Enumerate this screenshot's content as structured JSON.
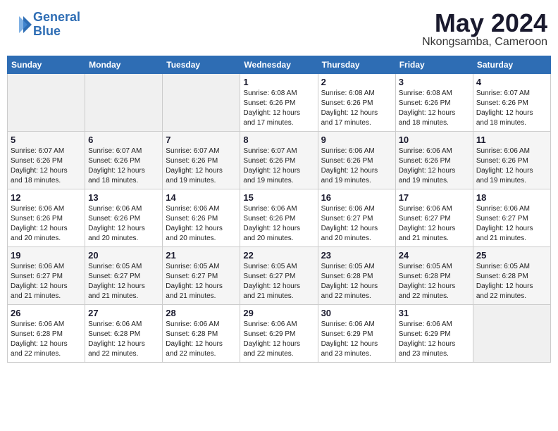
{
  "header": {
    "logo_line1": "General",
    "logo_line2": "Blue",
    "month_year": "May 2024",
    "location": "Nkongsamba, Cameroon"
  },
  "weekdays": [
    "Sunday",
    "Monday",
    "Tuesday",
    "Wednesday",
    "Thursday",
    "Friday",
    "Saturday"
  ],
  "weeks": [
    [
      {
        "day": "",
        "info": ""
      },
      {
        "day": "",
        "info": ""
      },
      {
        "day": "",
        "info": ""
      },
      {
        "day": "1",
        "info": "Sunrise: 6:08 AM\nSunset: 6:26 PM\nDaylight: 12 hours\nand 17 minutes."
      },
      {
        "day": "2",
        "info": "Sunrise: 6:08 AM\nSunset: 6:26 PM\nDaylight: 12 hours\nand 17 minutes."
      },
      {
        "day": "3",
        "info": "Sunrise: 6:08 AM\nSunset: 6:26 PM\nDaylight: 12 hours\nand 18 minutes."
      },
      {
        "day": "4",
        "info": "Sunrise: 6:07 AM\nSunset: 6:26 PM\nDaylight: 12 hours\nand 18 minutes."
      }
    ],
    [
      {
        "day": "5",
        "info": "Sunrise: 6:07 AM\nSunset: 6:26 PM\nDaylight: 12 hours\nand 18 minutes."
      },
      {
        "day": "6",
        "info": "Sunrise: 6:07 AM\nSunset: 6:26 PM\nDaylight: 12 hours\nand 18 minutes."
      },
      {
        "day": "7",
        "info": "Sunrise: 6:07 AM\nSunset: 6:26 PM\nDaylight: 12 hours\nand 19 minutes."
      },
      {
        "day": "8",
        "info": "Sunrise: 6:07 AM\nSunset: 6:26 PM\nDaylight: 12 hours\nand 19 minutes."
      },
      {
        "day": "9",
        "info": "Sunrise: 6:06 AM\nSunset: 6:26 PM\nDaylight: 12 hours\nand 19 minutes."
      },
      {
        "day": "10",
        "info": "Sunrise: 6:06 AM\nSunset: 6:26 PM\nDaylight: 12 hours\nand 19 minutes."
      },
      {
        "day": "11",
        "info": "Sunrise: 6:06 AM\nSunset: 6:26 PM\nDaylight: 12 hours\nand 19 minutes."
      }
    ],
    [
      {
        "day": "12",
        "info": "Sunrise: 6:06 AM\nSunset: 6:26 PM\nDaylight: 12 hours\nand 20 minutes."
      },
      {
        "day": "13",
        "info": "Sunrise: 6:06 AM\nSunset: 6:26 PM\nDaylight: 12 hours\nand 20 minutes."
      },
      {
        "day": "14",
        "info": "Sunrise: 6:06 AM\nSunset: 6:26 PM\nDaylight: 12 hours\nand 20 minutes."
      },
      {
        "day": "15",
        "info": "Sunrise: 6:06 AM\nSunset: 6:26 PM\nDaylight: 12 hours\nand 20 minutes."
      },
      {
        "day": "16",
        "info": "Sunrise: 6:06 AM\nSunset: 6:27 PM\nDaylight: 12 hours\nand 20 minutes."
      },
      {
        "day": "17",
        "info": "Sunrise: 6:06 AM\nSunset: 6:27 PM\nDaylight: 12 hours\nand 21 minutes."
      },
      {
        "day": "18",
        "info": "Sunrise: 6:06 AM\nSunset: 6:27 PM\nDaylight: 12 hours\nand 21 minutes."
      }
    ],
    [
      {
        "day": "19",
        "info": "Sunrise: 6:06 AM\nSunset: 6:27 PM\nDaylight: 12 hours\nand 21 minutes."
      },
      {
        "day": "20",
        "info": "Sunrise: 6:05 AM\nSunset: 6:27 PM\nDaylight: 12 hours\nand 21 minutes."
      },
      {
        "day": "21",
        "info": "Sunrise: 6:05 AM\nSunset: 6:27 PM\nDaylight: 12 hours\nand 21 minutes."
      },
      {
        "day": "22",
        "info": "Sunrise: 6:05 AM\nSunset: 6:27 PM\nDaylight: 12 hours\nand 21 minutes."
      },
      {
        "day": "23",
        "info": "Sunrise: 6:05 AM\nSunset: 6:28 PM\nDaylight: 12 hours\nand 22 minutes."
      },
      {
        "day": "24",
        "info": "Sunrise: 6:05 AM\nSunset: 6:28 PM\nDaylight: 12 hours\nand 22 minutes."
      },
      {
        "day": "25",
        "info": "Sunrise: 6:05 AM\nSunset: 6:28 PM\nDaylight: 12 hours\nand 22 minutes."
      }
    ],
    [
      {
        "day": "26",
        "info": "Sunrise: 6:06 AM\nSunset: 6:28 PM\nDaylight: 12 hours\nand 22 minutes."
      },
      {
        "day": "27",
        "info": "Sunrise: 6:06 AM\nSunset: 6:28 PM\nDaylight: 12 hours\nand 22 minutes."
      },
      {
        "day": "28",
        "info": "Sunrise: 6:06 AM\nSunset: 6:28 PM\nDaylight: 12 hours\nand 22 minutes."
      },
      {
        "day": "29",
        "info": "Sunrise: 6:06 AM\nSunset: 6:29 PM\nDaylight: 12 hours\nand 22 minutes."
      },
      {
        "day": "30",
        "info": "Sunrise: 6:06 AM\nSunset: 6:29 PM\nDaylight: 12 hours\nand 23 minutes."
      },
      {
        "day": "31",
        "info": "Sunrise: 6:06 AM\nSunset: 6:29 PM\nDaylight: 12 hours\nand 23 minutes."
      },
      {
        "day": "",
        "info": ""
      }
    ]
  ]
}
